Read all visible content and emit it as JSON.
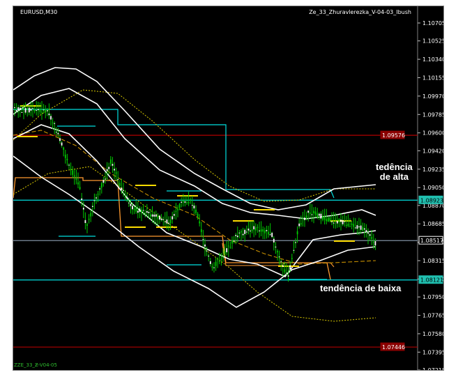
{
  "header": {
    "symbol": "EURUSD,M30",
    "indicator": "Ze_33_Zhuravlerezka_V-04-03_Ibush"
  },
  "annotations": {
    "uptrend_1": "tedência",
    "uptrend_2": "de alta",
    "downtrend": "tendência de baixa"
  },
  "footer": {
    "id": "ZZE_33_Z̴-V04-05"
  },
  "price_axis": {
    "labels": [
      "1.10705",
      "1.10525",
      "1.10340",
      "1.10155",
      "1.09970",
      "1.09785",
      "1.09600",
      "1.09420",
      "1.09235",
      "1.09050",
      "1.08870",
      "1.08685",
      "1.08500",
      "1.08315",
      "1.08130",
      "1.07950",
      "1.07765",
      "1.07580",
      "1.07395",
      "1.07215"
    ],
    "highlighted": [
      {
        "value": "1.09576",
        "bg": "#8b0000",
        "fg": "#ffffff"
      },
      {
        "value": "1.08923",
        "bg": "#20c0b0",
        "fg": "#000000"
      },
      {
        "value": "1.08517",
        "bg": "#000000",
        "fg": "#ffffff"
      },
      {
        "value": "1.08121",
        "bg": "#20c0b0",
        "fg": "#000000"
      },
      {
        "value": "1.07446",
        "bg": "#8b0000",
        "fg": "#ffffff"
      }
    ]
  },
  "colors": {
    "background": "#000000",
    "candles": "#00cc00",
    "bands": "#ffffff",
    "dotted_bands": "#e0d000",
    "ma_line": "#c89000",
    "support_resistance": "#00e0e0",
    "red_levels": "#b00000",
    "orange_steps": "#ff9a30",
    "yellow_marks": "#ffdd00"
  }
}
